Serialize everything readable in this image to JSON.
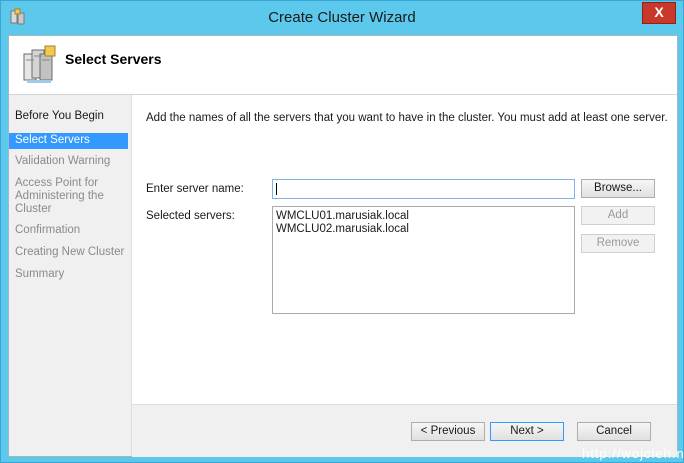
{
  "window": {
    "title": "Create Cluster Wizard",
    "close_glyph": "X"
  },
  "page": {
    "title": "Select Servers"
  },
  "nav": [
    {
      "label": "Before You Begin",
      "state": "done"
    },
    {
      "label": "Select Servers",
      "state": "active"
    },
    {
      "label": "Validation Warning",
      "state": "pending"
    },
    {
      "label": "Access Point for Administering the Cluster",
      "state": "pending"
    },
    {
      "label": "Confirmation",
      "state": "pending"
    },
    {
      "label": "Creating New Cluster",
      "state": "pending"
    },
    {
      "label": "Summary",
      "state": "pending"
    }
  ],
  "content": {
    "intro": "Add the names of all the servers that you want to have in the cluster. You must add at least one server.",
    "server_name_label": "Enter server name:",
    "server_name_value": "",
    "selected_label": "Selected servers:",
    "selected_servers": [
      "WMCLU01.marusiak.local",
      "WMCLU02.marusiak.local"
    ],
    "browse_label": "Browse...",
    "add_label": "Add",
    "remove_label": "Remove"
  },
  "footer": {
    "previous_label": "< Previous",
    "next_label": "Next >",
    "cancel_label": "Cancel"
  },
  "watermark": "http://wojcieh.ne",
  "colors": {
    "titlebar": "#5bc8ec",
    "selection": "#3399ff",
    "close": "#c8392b"
  },
  "icons": {
    "app": "cluster-app-icon",
    "header": "server-stack-icon"
  }
}
